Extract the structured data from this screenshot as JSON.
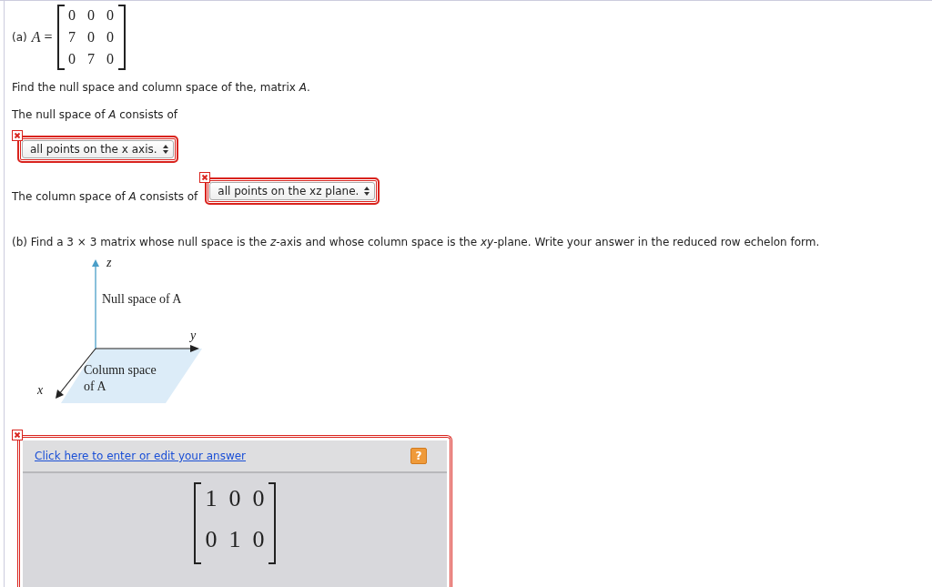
{
  "part_a": {
    "label": "(a)",
    "lhs": "*A* =",
    "matrix": [
      [
        "0",
        "0",
        "0"
      ],
      [
        "7",
        "0",
        "0"
      ],
      [
        "0",
        "7",
        "0"
      ]
    ],
    "prompt": "Find the null space and column space of the, matrix *A*.",
    "null_space": {
      "text": "The null space of *A* consists of",
      "answer": "all points on the x axis.",
      "incorrect": true
    },
    "column_space": {
      "text": "The column space of *A* consists of",
      "answer": "all points on the xz plane.",
      "incorrect": true
    }
  },
  "part_b": {
    "prompt": "(b) Find a 3 × 3 matrix whose null space is the *z*-axis and whose column space is the *xy*-plane. Write your answer in the reduced row echelon form.",
    "figure": {
      "z_label": "z",
      "y_label": "y",
      "x_label": "x",
      "null_space_label": "Null space of A",
      "column_space_label": [
        "Column space",
        "of A"
      ]
    },
    "answer": {
      "incorrect": true,
      "link": "Click here to enter or edit your answer",
      "help": "?",
      "matrix": [
        [
          "1",
          "0",
          "0"
        ],
        [
          "0",
          "1",
          "0"
        ]
      ]
    }
  }
}
